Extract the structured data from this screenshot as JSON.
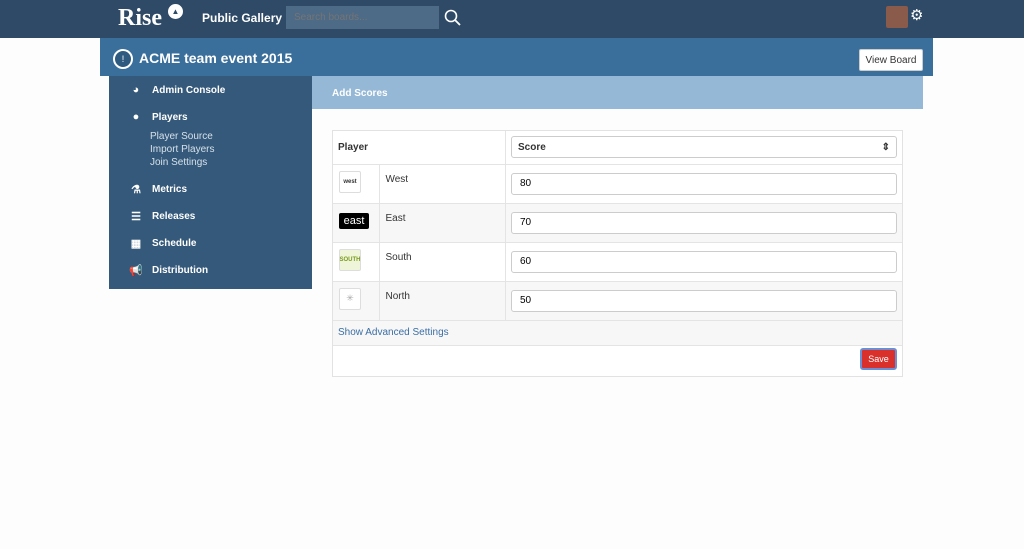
{
  "topbar": {
    "logo": "Rise",
    "nav_link": "Public Gallery",
    "search_placeholder": "Search boards..."
  },
  "board": {
    "title": "ACME team event 2015",
    "view_button": "View Board"
  },
  "sidebar": {
    "items": [
      {
        "label": "Admin Console",
        "icon": "dashboard-icon"
      },
      {
        "label": "Players",
        "icon": "user-icon",
        "sub": [
          "Player Source",
          "Import Players",
          "Join Settings"
        ]
      },
      {
        "label": "Metrics",
        "icon": "flask-icon"
      },
      {
        "label": "Releases",
        "icon": "list-icon"
      },
      {
        "label": "Schedule",
        "icon": "calendar-icon"
      },
      {
        "label": "Distribution",
        "icon": "megaphone-icon"
      }
    ]
  },
  "main": {
    "heading": "Add Scores",
    "col_player": "Player",
    "col_score": "Score",
    "rows": [
      {
        "logo": "west",
        "name": "West",
        "score": "80"
      },
      {
        "logo": "east",
        "name": "East",
        "score": "70"
      },
      {
        "logo": "SOUTH",
        "name": "South",
        "score": "60"
      },
      {
        "logo": "",
        "name": "North",
        "score": "50"
      }
    ],
    "advanced": "Show Advanced Settings",
    "save": "Save"
  }
}
